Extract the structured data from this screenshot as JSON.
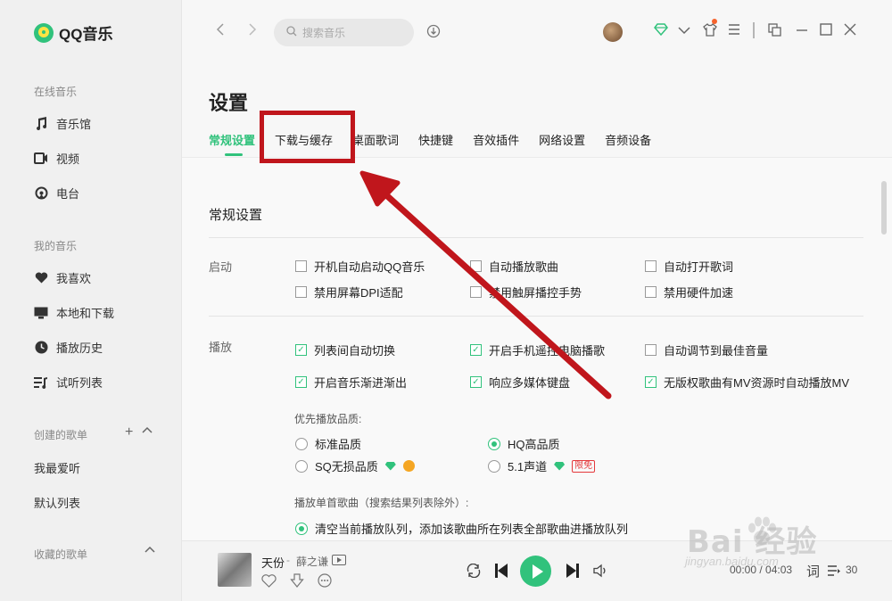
{
  "app": {
    "name": "QQ音乐",
    "brand_color": "#31c27c"
  },
  "sidebar": {
    "online_section": "在线音乐",
    "online_items": [
      {
        "label": "音乐馆",
        "icon": "music-note-icon"
      },
      {
        "label": "视频",
        "icon": "video-icon"
      },
      {
        "label": "电台",
        "icon": "radio-icon"
      }
    ],
    "my_section": "我的音乐",
    "my_items": [
      {
        "label": "我喜欢",
        "icon": "heart-icon"
      },
      {
        "label": "本地和下载",
        "icon": "monitor-icon"
      },
      {
        "label": "播放历史",
        "icon": "clock-icon"
      },
      {
        "label": "试听列表",
        "icon": "playlist-icon"
      }
    ],
    "created_section": "创建的歌单",
    "created_items": [
      "我最爱听",
      "默认列表"
    ],
    "collected_section": "收藏的歌单"
  },
  "topbar": {
    "search_placeholder": "搜索音乐"
  },
  "settings": {
    "title": "设置",
    "tabs": [
      "常规设置",
      "下载与缓存",
      "桌面歌词",
      "快捷键",
      "音效插件",
      "网络设置",
      "音频设备"
    ],
    "active_tab": "常规设置",
    "section_title": "常规设置",
    "startup": {
      "label": "启动",
      "options": [
        {
          "label": "开机自动启动QQ音乐",
          "checked": false
        },
        {
          "label": "自动播放歌曲",
          "checked": false
        },
        {
          "label": "自动打开歌词",
          "checked": false
        },
        {
          "label": "禁用屏幕DPI适配",
          "checked": false
        },
        {
          "label": "禁用触屏播控手势",
          "checked": false
        },
        {
          "label": "禁用硬件加速",
          "checked": false
        }
      ]
    },
    "playback": {
      "label": "播放",
      "options": [
        {
          "label": "列表间自动切换",
          "checked": true
        },
        {
          "label": "开启手机遥控电脑播歌",
          "checked": true
        },
        {
          "label": "自动调节到最佳音量",
          "checked": false
        },
        {
          "label": "开启音乐渐进渐出",
          "checked": true
        },
        {
          "label": "响应多媒体键盘",
          "checked": true
        },
        {
          "label": "无版权歌曲有MV资源时自动播放MV",
          "checked": true
        }
      ],
      "quality_label": "优先播放品质:",
      "quality_options": [
        {
          "label": "标准品质",
          "selected": false
        },
        {
          "label": "HQ高品质",
          "selected": true
        },
        {
          "label": "SQ无损品质",
          "selected": false
        },
        {
          "label": "5.1声道",
          "selected": false,
          "tag": "限免"
        }
      ],
      "single_label": "播放单首歌曲（搜索结果列表除外）:",
      "single_option": "清空当前播放队列，添加该歌曲所在列表全部歌曲进播放队列"
    }
  },
  "player": {
    "title": "天份",
    "artist": "薛之谦",
    "time": "00:00 / 04:03",
    "lyric_label": "词",
    "queue_count": "30"
  },
  "watermark": {
    "text": "Bai 经验",
    "sub": "jingyan.baidu.com"
  }
}
